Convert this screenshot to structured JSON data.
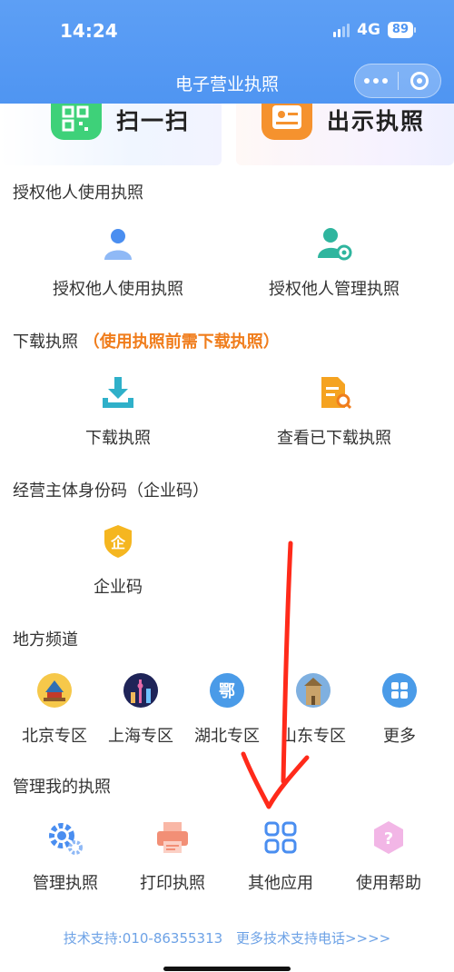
{
  "status_bar": {
    "time": "14:24",
    "network": "4G",
    "battery": "89"
  },
  "nav": {
    "title": "电子营业执照"
  },
  "top_cards": {
    "scan_label": "扫一扫",
    "show_label": "出示执照"
  },
  "sections": {
    "authorize": {
      "title": "授权他人使用执照",
      "items": [
        "授权他人使用执照",
        "授权他人管理执照"
      ]
    },
    "download": {
      "title": "下载执照",
      "note": "（使用执照前需下载执照）",
      "items": [
        "下载执照",
        "查看已下载执照"
      ]
    },
    "enterprise_code": {
      "title": "经营主体身份码（企业码）",
      "items": [
        "企业码"
      ],
      "icon_char": "企"
    },
    "local": {
      "title": "地方频道",
      "items": [
        "北京专区",
        "上海专区",
        "湖北专区",
        "山东专区",
        "更多"
      ],
      "hubei_char": "鄂"
    },
    "manage": {
      "title": "管理我的执照",
      "items": [
        "管理执照",
        "打印执照",
        "其他应用",
        "使用帮助"
      ]
    }
  },
  "footer": {
    "support": "技术支持:010-86355313",
    "more": "更多技术支持电话>>>>"
  },
  "colors": {
    "header_blue": "#4f95f2",
    "icon_blue": "#4a8ef0",
    "accent_orange": "#f07d1c",
    "annotation_red": "#ff2a1a"
  }
}
